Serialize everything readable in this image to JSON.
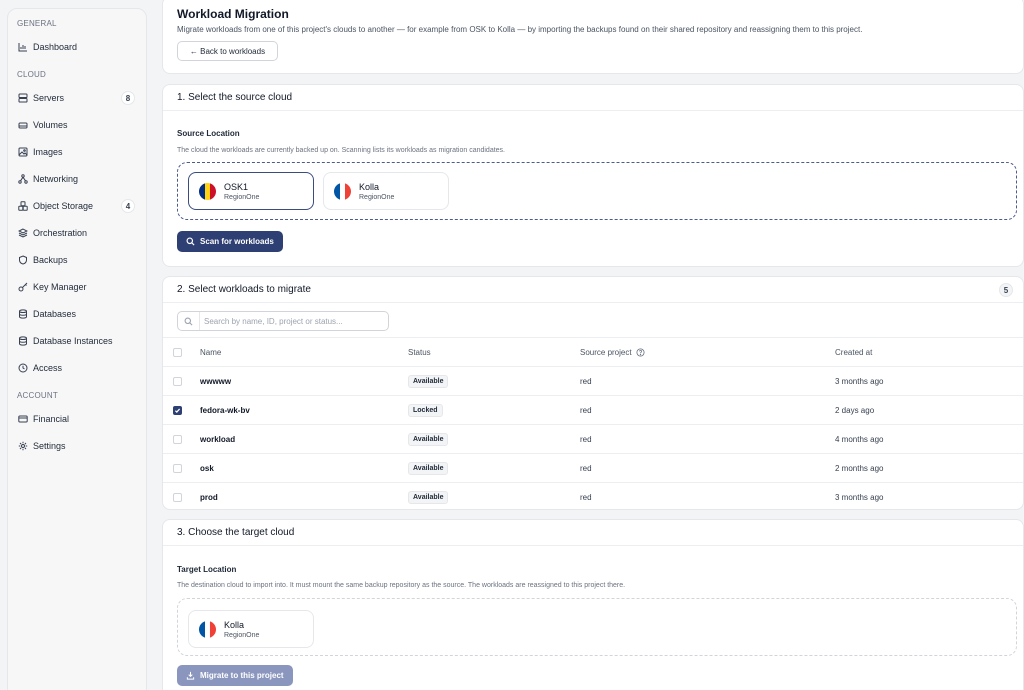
{
  "sidebar": {
    "sections": {
      "general": "GENERAL",
      "cloud": "CLOUD",
      "account": "ACCOUNT"
    },
    "items": {
      "dashboard": "Dashboard",
      "servers": "Servers",
      "servers_count": "8",
      "volumes": "Volumes",
      "images": "Images",
      "networking": "Networking",
      "object_storage": "Object Storage",
      "object_storage_count": "4",
      "orchestration": "Orchestration",
      "backups": "Backups",
      "key_manager": "Key Manager",
      "databases": "Databases",
      "database_instances": "Database Instances",
      "access": "Access",
      "financial": "Financial",
      "settings": "Settings"
    }
  },
  "header": {
    "title": "Workload Migration",
    "description": "Migrate workloads from one of this project's clouds to another — for example from OSK to Kolla — by importing the backups found on their shared repository and reassigning them to this project.",
    "back_label": "← Back to workloads"
  },
  "step1": {
    "title": "1. Select the source cloud",
    "label": "Source Location",
    "help": "The cloud the workloads are currently backed up on. Scanning lists its workloads as migration candidates.",
    "clouds": [
      {
        "name": "OSK1",
        "region": "RegionOne",
        "selected": true,
        "flag": [
          "#002b7f",
          "#fcd116",
          "#ce1126"
        ]
      },
      {
        "name": "Kolla",
        "region": "RegionOne",
        "selected": false,
        "flag": [
          "#0055a4",
          "#ffffff",
          "#ef4135"
        ]
      }
    ],
    "scan_label": "Scan for workloads"
  },
  "step2": {
    "title": "2. Select workloads to migrate",
    "count": "5",
    "search_placeholder": "Search by name, ID, project or status...",
    "columns": {
      "name": "Name",
      "status": "Status",
      "project": "Source project",
      "created": "Created at"
    },
    "rows": [
      {
        "name": "wwwww",
        "status": "Available",
        "project": "red",
        "created": "3 months ago",
        "checked": false
      },
      {
        "name": "fedora-wk-bv",
        "status": "Locked",
        "project": "red",
        "created": "2 days ago",
        "checked": true
      },
      {
        "name": "workload",
        "status": "Available",
        "project": "red",
        "created": "4 months ago",
        "checked": false
      },
      {
        "name": "osk",
        "status": "Available",
        "project": "red",
        "created": "2 months ago",
        "checked": false
      },
      {
        "name": "prod",
        "status": "Available",
        "project": "red",
        "created": "3 months ago",
        "checked": false
      }
    ]
  },
  "step3": {
    "title": "3. Choose the target cloud",
    "label": "Target Location",
    "help": "The destination cloud to import into. It must mount the same backup repository as the source. The workloads are reassigned to this project there.",
    "clouds": [
      {
        "name": "Kolla",
        "region": "RegionOne",
        "flag": [
          "#0055a4",
          "#ffffff",
          "#ef4135"
        ]
      }
    ],
    "migrate_label": "Migrate to this project"
  }
}
